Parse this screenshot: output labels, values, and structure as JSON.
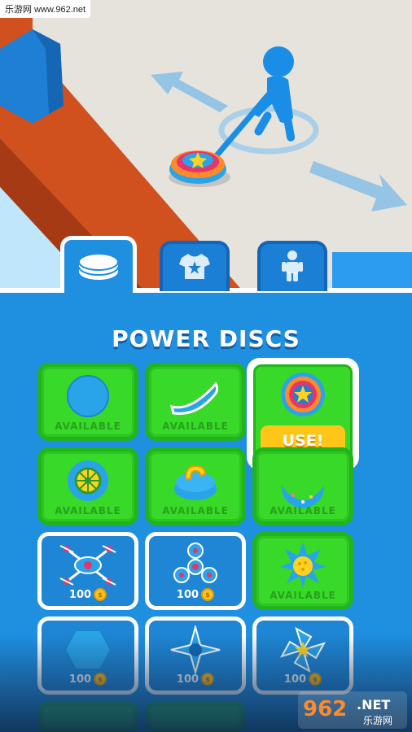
{
  "watermark": {
    "top_text": "乐游网 www.962.net",
    "logo_brand": "962",
    "logo_suffix": ".NET",
    "logo_sub": "乐游网"
  },
  "tabs": [
    {
      "icon": "disc-stack-icon",
      "active": true
    },
    {
      "icon": "tshirt-star-icon",
      "active": false
    },
    {
      "icon": "character-icon",
      "active": false
    }
  ],
  "shop": {
    "title": "POWER DISCS",
    "use_label": "USE!",
    "items": [
      {
        "icon": "plain-disc-icon",
        "status": "AVAILABLE"
      },
      {
        "icon": "boomerang-icon",
        "status": "AVAILABLE"
      },
      {
        "icon": "star-disc-icon",
        "status": "SELECTED"
      },
      {
        "icon": "wheel-disc-icon",
        "status": "AVAILABLE"
      },
      {
        "icon": "curling-stone-icon",
        "status": "AVAILABLE"
      },
      {
        "icon": "donut-icon",
        "status": "AVAILABLE"
      },
      {
        "icon": "drone-icon",
        "status": "LOCKED",
        "price": "100"
      },
      {
        "icon": "fidget-spinner-icon",
        "status": "LOCKED",
        "price": "100"
      },
      {
        "icon": "spiked-ball-icon",
        "status": "AVAILABLE"
      },
      {
        "icon": "hexagon-icon",
        "status": "LOCKED",
        "price": "100"
      },
      {
        "icon": "shuriken-icon",
        "status": "LOCKED",
        "price": "100"
      },
      {
        "icon": "pinwheel-icon",
        "status": "LOCKED",
        "price": "100"
      }
    ]
  },
  "colors": {
    "panel": "#1f8fe0",
    "card_green": "#38d928",
    "use_button": "#ffc61a",
    "character": "#1a8ee6"
  }
}
